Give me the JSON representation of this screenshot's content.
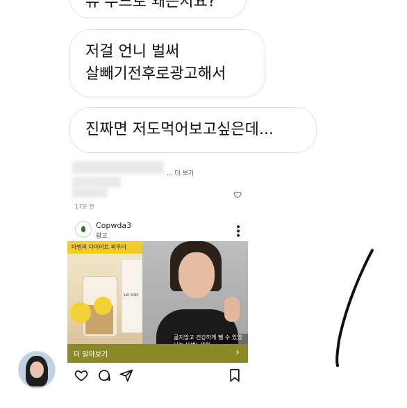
{
  "messages": [
    {
      "text": "뷰 푸드로 왜는지요?"
    },
    {
      "text_line1": "저걸 언니 벌써",
      "text_line2": "살빼기전후로광고해서"
    },
    {
      "text": "진짜면 저도먹어보고싶은데..."
    }
  ],
  "post": {
    "more_label": "... 더 보기",
    "time_ago": "17분 전",
    "account_name": "Copwda3",
    "sponsored_label": "광고",
    "banner_text": "마법의 다이어트 파우더",
    "bottle_text": "Le sac",
    "caption_text": "굶지않고 건강하게 뺄 수 있었다는 비법! 쇄원",
    "cta_label": "더 알아보기",
    "cta_chevron": "›"
  },
  "icons": {
    "like": "heart-icon",
    "comment": "comment-icon",
    "share": "send-icon",
    "save": "bookmark-icon"
  },
  "colors": {
    "cta_bg": "#8a8a2a",
    "banner_bg": "#f2cc2a"
  }
}
